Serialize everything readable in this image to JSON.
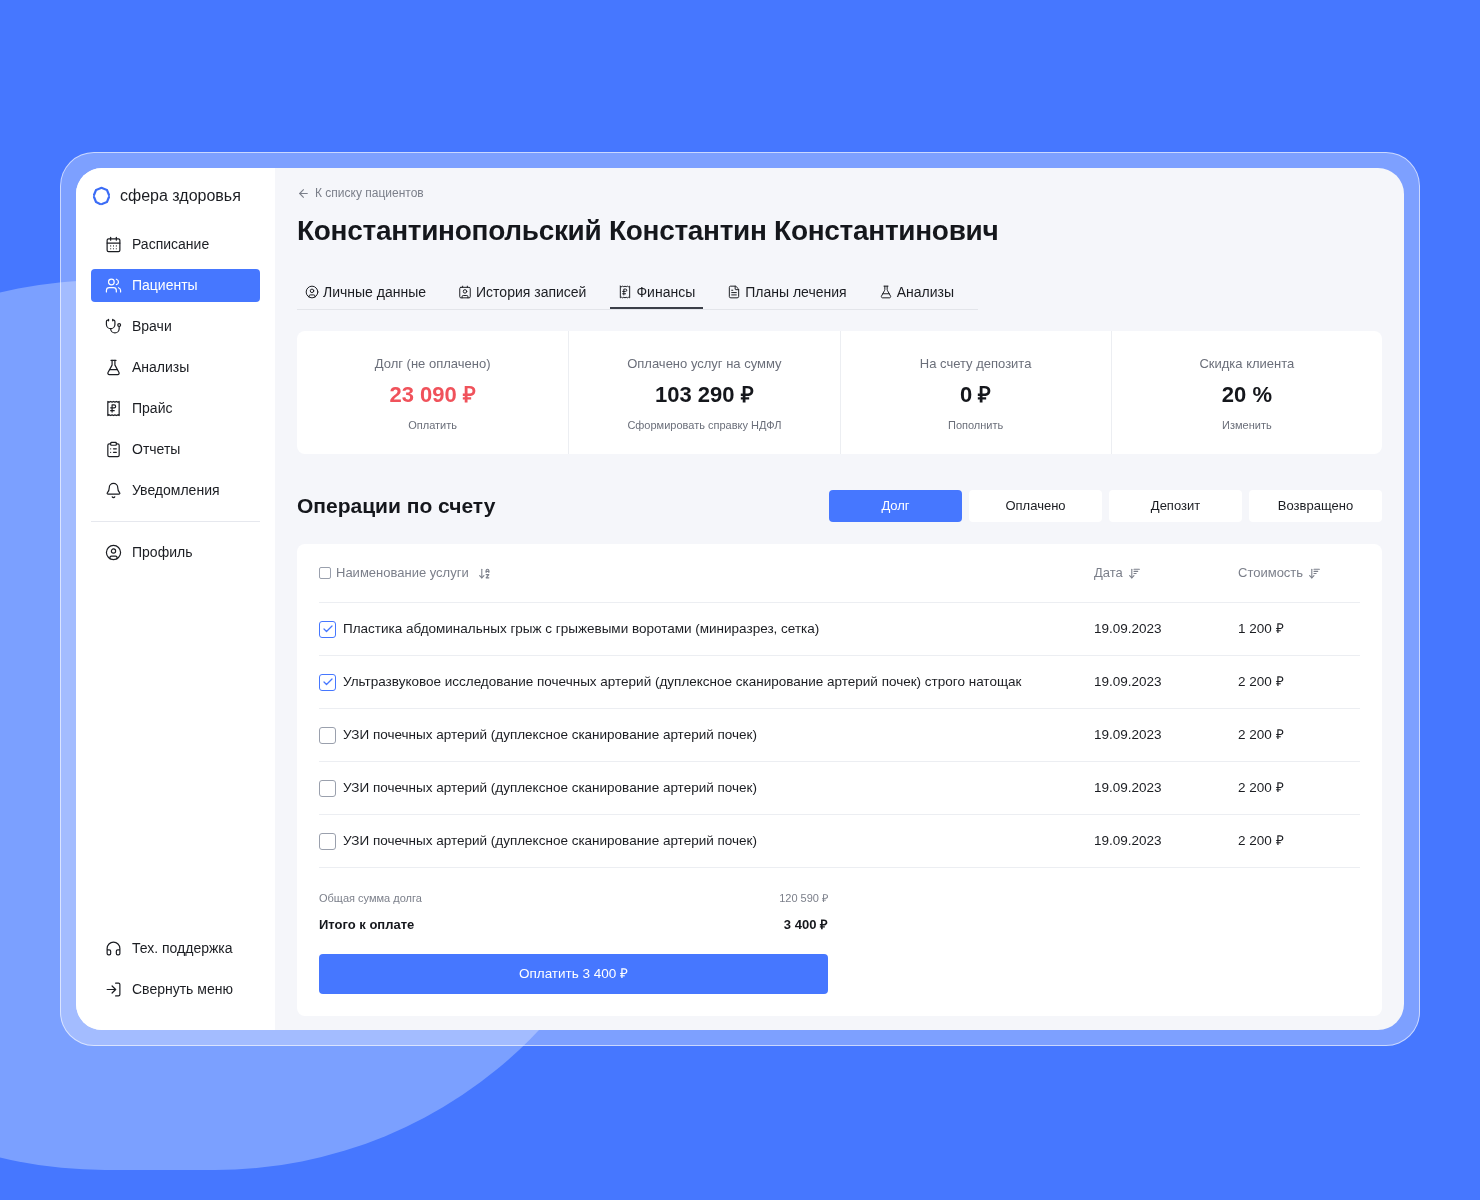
{
  "brand": {
    "name": "сфера здоровья"
  },
  "sidebar": {
    "items": [
      {
        "label": "Расписание",
        "selected": false
      },
      {
        "label": "Пациенты",
        "selected": true
      },
      {
        "label": "Врачи",
        "selected": false
      },
      {
        "label": "Анализы",
        "selected": false
      },
      {
        "label": "Прайс",
        "selected": false
      },
      {
        "label": "Отчеты",
        "selected": false
      },
      {
        "label": "Уведомления",
        "selected": false
      }
    ],
    "profile": {
      "label": "Профиль"
    },
    "bottom_items": [
      {
        "label": "Тех. поддержка"
      },
      {
        "label": "Свернуть меню"
      }
    ]
  },
  "back_link": "К списку пациентов",
  "patient_name": "Константинопольский Константин Константинович",
  "tabs": [
    {
      "label": "Личные данные",
      "selected": false
    },
    {
      "label": "История записей",
      "selected": false
    },
    {
      "label": "Финансы",
      "selected": true
    },
    {
      "label": "Планы лечения",
      "selected": false
    },
    {
      "label": "Анализы",
      "selected": false
    }
  ],
  "summary_cards": [
    {
      "title": "Долг (не оплачено)",
      "value": "23 090 ₽",
      "kind": "debt",
      "action": "Оплатить"
    },
    {
      "title": "Оплачено услуг на сумму",
      "value": "103 290 ₽",
      "kind": "normal",
      "action": "Сформировать справку НДФЛ"
    },
    {
      "title": "На счету депозита",
      "value": "0 ₽",
      "kind": "normal",
      "action": "Пополнить"
    },
    {
      "title": "Скидка клиента",
      "value": "20 %",
      "kind": "normal",
      "action": "Изменить"
    }
  ],
  "operations": {
    "title": "Операции по счету",
    "filters": [
      {
        "label": "Долг",
        "selected": true
      },
      {
        "label": "Оплачено",
        "selected": false
      },
      {
        "label": "Депозит",
        "selected": false
      },
      {
        "label": "Возвращено",
        "selected": false
      }
    ],
    "table": {
      "columns": [
        "Наименование услуги",
        "Дата",
        "Стоимость"
      ],
      "select_all_checked": false,
      "rows": [
        {
          "service": "Пластика абдоминальных грыж с грыжевыми воротами (миниразрез, сетка)",
          "date": "19.09.2023",
          "price": "1 200 ₽",
          "checked": true
        },
        {
          "service": "Ультразвуковое исследование почечных артерий (дуплексное сканирование артерий почек) строго натощак",
          "date": "19.09.2023",
          "price": "2 200 ₽",
          "checked": true
        },
        {
          "service": "УЗИ почечных артерий (дуплексное сканирование артерий почек)",
          "date": "19.09.2023",
          "price": "2 200 ₽",
          "checked": false
        },
        {
          "service": "УЗИ почечных артерий (дуплексное сканирование артерий почек)",
          "date": "19.09.2023",
          "price": "2 200 ₽",
          "checked": false
        },
        {
          "service": "УЗИ почечных артерий (дуплексное сканирование артерий почек)",
          "date": "19.09.2023",
          "price": "2 200 ₽",
          "checked": false
        }
      ]
    },
    "total_label": "Общая сумма долга",
    "total_value": "120 590 ₽",
    "due_label": "Итого к оплате",
    "due_value": "3 400 ₽",
    "pay_button": "Оплатить 3 400 ₽"
  }
}
